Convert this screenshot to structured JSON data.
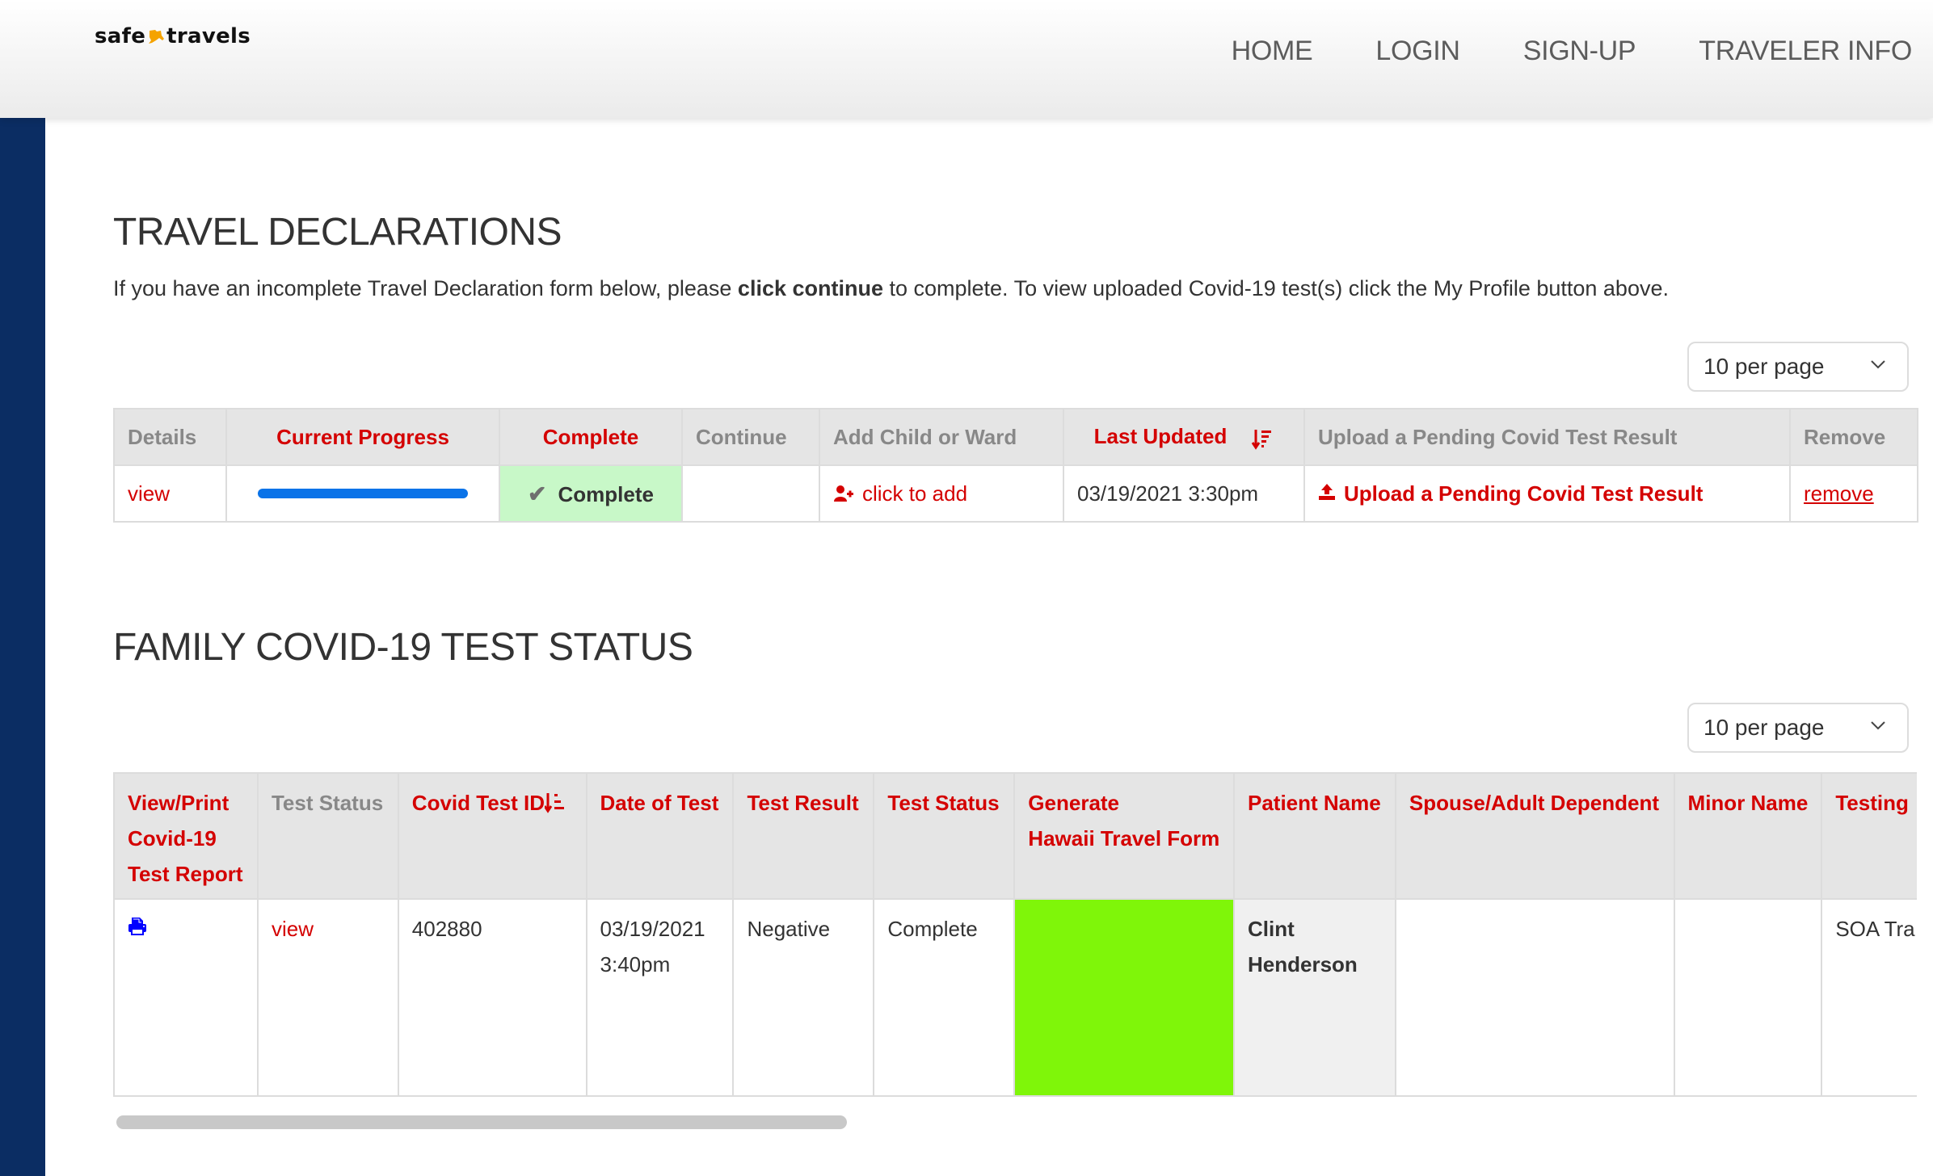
{
  "header": {
    "logo_left": "safe",
    "logo_right": "travels",
    "nav": [
      "HOME",
      "LOGIN",
      "SIGN-UP",
      "TRAVELER INFO"
    ]
  },
  "declarations": {
    "title": "TRAVEL DECLARATIONS",
    "intro_before": "If you have an incomplete Travel Declaration form below, please ",
    "intro_bold": "click continue",
    "intro_after": " to complete. To view uploaded Covid-19 test(s) click the My Profile button above.",
    "per_page": "10 per page",
    "columns": [
      "Details",
      "Current Progress",
      "Complete",
      "Continue",
      "Add Child or Ward",
      "Last Updated",
      "Upload a Pending Covid Test Result",
      "Remove"
    ],
    "row": {
      "details": "view",
      "progress_percent": 100,
      "complete": "Complete",
      "continue": "",
      "add_child": "click to add",
      "last_updated": "03/19/2021 3:30pm",
      "upload": "Upload a Pending Covid Test Result",
      "remove": "remove"
    }
  },
  "family": {
    "title": "FAMILY COVID-19 TEST STATUS",
    "per_page": "10 per page",
    "columns": {
      "view_print": [
        "View/Print",
        "Covid-19",
        "Test Report"
      ],
      "test_status_1": "Test Status",
      "covid_test_id": "Covid Test ID",
      "date_of_test": "Date of Test",
      "test_result": "Test Result",
      "test_status_2": "Test Status",
      "generate": [
        "Generate",
        "Hawaii Travel Form"
      ],
      "patient_name": "Patient Name",
      "spouse": "Spouse/Adult Dependent",
      "minor": "Minor Name",
      "testing": "Testing"
    },
    "row": {
      "test_status_link": "view",
      "covid_test_id": "402880",
      "date": "03/19/2021",
      "time": "3:40pm",
      "result": "Negative",
      "status": "Complete",
      "patient_first": "Clint",
      "patient_last": "Henderson",
      "spouse": "",
      "minor": "",
      "testing": "SOA Tra"
    }
  },
  "colors": {
    "accent_red": "#d40000",
    "sidebar_navy": "#0b2d63",
    "progress_blue": "#0a73e8",
    "complete_green_bg": "#c8f8c8",
    "hawaii_green": "#7ff609",
    "print_icon_blue": "#0000ff"
  }
}
